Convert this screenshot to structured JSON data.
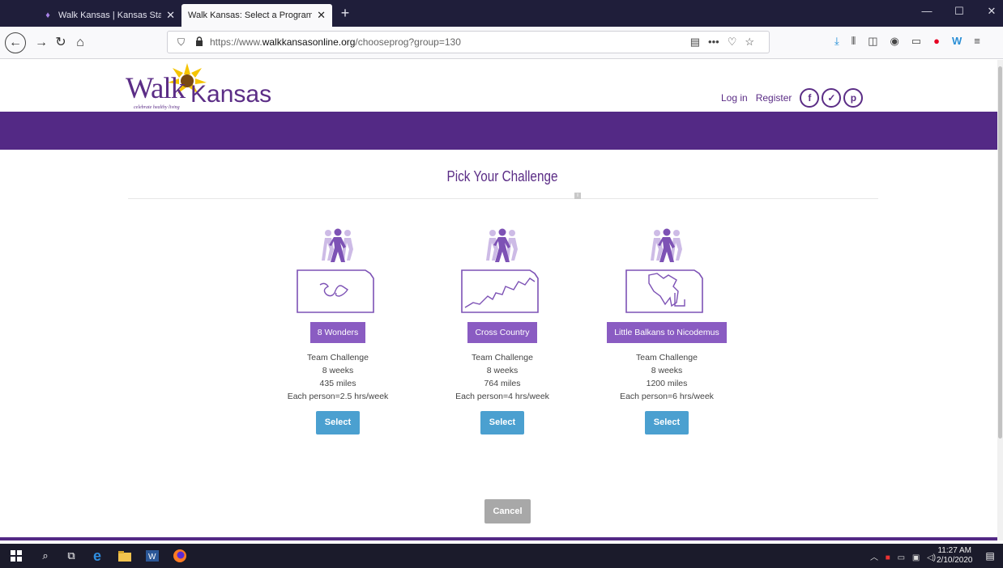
{
  "browser": {
    "tabs": [
      {
        "title": "Walk Kansas | Kansas State Uni",
        "active": false
      },
      {
        "title": "Walk Kansas: Select a Program",
        "active": true
      }
    ],
    "url_prefix": "https://www.",
    "url_domain": "walkkansasonline.org",
    "url_path": "/chooseprog?group=130"
  },
  "site": {
    "logo_walk": "Walk",
    "logo_kansas": "Kansas",
    "logo_tagline": "celebrate healthy living",
    "nav": {
      "login": "Log in",
      "register": "Register"
    },
    "social": [
      "facebook-icon",
      "twitter-icon",
      "pinterest-icon"
    ]
  },
  "main": {
    "heading": "Pick Your Challenge",
    "info_glyph": "i",
    "cancel_label": "Cancel"
  },
  "challenges": [
    {
      "name": "8 Wonders",
      "type": "Team Challenge",
      "duration": "8 weeks",
      "distance": "435 miles",
      "per_person": "Each person=2.5 hrs/week",
      "select_label": "Select"
    },
    {
      "name": "Cross Country",
      "type": "Team Challenge",
      "duration": "8 weeks",
      "distance": "764 miles",
      "per_person": "Each person=4 hrs/week",
      "select_label": "Select"
    },
    {
      "name": "Little Balkans to Nicodemus",
      "type": "Team Challenge",
      "duration": "8 weeks",
      "distance": "1200 miles",
      "per_person": "Each person=6 hrs/week",
      "select_label": "Select"
    }
  ],
  "taskbar": {
    "time": "11:27 AM",
    "date": "2/10/2020"
  },
  "colors": {
    "brand_purple": "#532985",
    "label_purple": "#8a5cc2",
    "select_blue": "#4ba0d0",
    "cancel_gray": "#a8a8a8"
  }
}
